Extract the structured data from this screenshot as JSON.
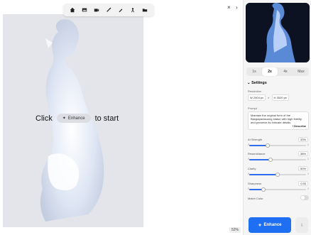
{
  "toolbar": {
    "tools": [
      {
        "icon": "home-icon"
      },
      {
        "icon": "image-icon"
      },
      {
        "icon": "video-icon"
      },
      {
        "icon": "wand-icon"
      },
      {
        "icon": "brush-icon"
      },
      {
        "icon": "person-icon"
      },
      {
        "icon": "folder-icon"
      }
    ]
  },
  "canvas": {
    "start_before": "Click",
    "start_button": "Enhance",
    "start_after": "to start",
    "zoom": "52%",
    "close": "×",
    "next": "›"
  },
  "sidebar": {
    "scales": [
      {
        "label": "1x",
        "active": false
      },
      {
        "label": "2x",
        "active": true
      },
      {
        "label": "4x",
        "active": false
      },
      {
        "label": "Max",
        "active": false
      }
    ],
    "settings_title": "Settings",
    "resolution_label": "Resolution",
    "width_prefix": "W",
    "width_value": "2904",
    "width_unit": "px",
    "sep": "×",
    "height_prefix": "H",
    "height_value": "3520",
    "height_unit": "px",
    "prompt_label": "Prompt",
    "prompt_text": "Maintain the original form of the Bangaparasuong statue with high fidelity and preserve its intricate details",
    "describe_label": "Describe",
    "sliders": [
      {
        "label": "AI Strength",
        "value_text": "33%",
        "value": 0.33,
        "min": "0",
        "max": "1"
      },
      {
        "label": "Resemblance",
        "value_text": "38%",
        "value": 0.38,
        "min": "0",
        "max": "1"
      },
      {
        "label": "Clarity",
        "value_text": "50%",
        "value": 0.5,
        "min": "0",
        "max": "1"
      },
      {
        "label": "Sharpness",
        "value_text": "0.50",
        "value": 0.25,
        "min": "0",
        "max": "2"
      }
    ],
    "match_color_label": "Match Color",
    "enhance_label": "Enhance",
    "download_icon": "download-icon"
  }
}
